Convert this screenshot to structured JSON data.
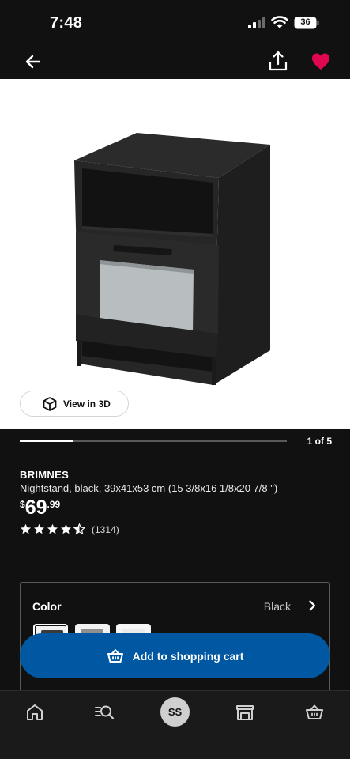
{
  "status_bar": {
    "time": "7:48",
    "battery": "36"
  },
  "nav": {
    "back_icon": "arrow-left-icon",
    "share_icon": "share-icon",
    "favorite_icon": "heart-icon",
    "favorite_color": "#e00751"
  },
  "gallery": {
    "view_3d_label": "View in 3D",
    "page_counter": "1 of 5",
    "progress": 0.2
  },
  "product": {
    "name": "BRIMNES",
    "description": "Nightstand, black, 39x41x53 cm (15 3/8x16 1/8x20 7/8 \")",
    "price_currency": "$",
    "price_integer": "69",
    "price_decimal": ".99",
    "rating": 4.5,
    "review_count": "(1314)"
  },
  "color_option": {
    "label": "Color",
    "value": "Black"
  },
  "cart": {
    "label": "Add to shopping cart",
    "color": "#0058a3"
  },
  "tab_bar": {
    "avatar_initials": "SS",
    "items": [
      "home-icon",
      "search-list-icon",
      "avatar",
      "store-icon",
      "basket-icon"
    ]
  }
}
